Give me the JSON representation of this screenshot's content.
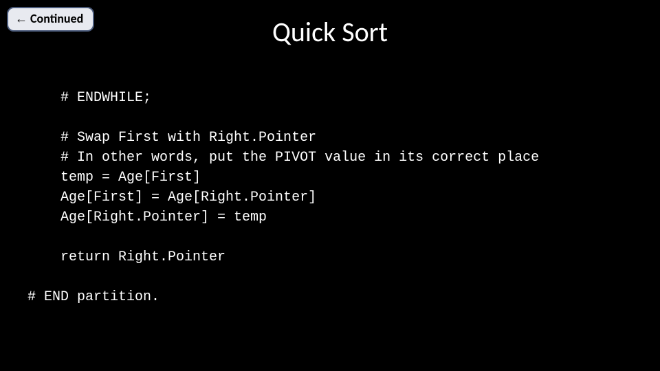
{
  "badge": {
    "arrow": "←",
    "label": "Continued"
  },
  "title": "Quick Sort",
  "code": "    # ENDWHILE;\n\n    # Swap First with Right.Pointer\n    # In other words, put the PIVOT value in its correct place\n    temp = Age[First]\n    Age[First] = Age[Right.Pointer]\n    Age[Right.Pointer] = temp\n\n    return Right.Pointer\n\n# END partition."
}
